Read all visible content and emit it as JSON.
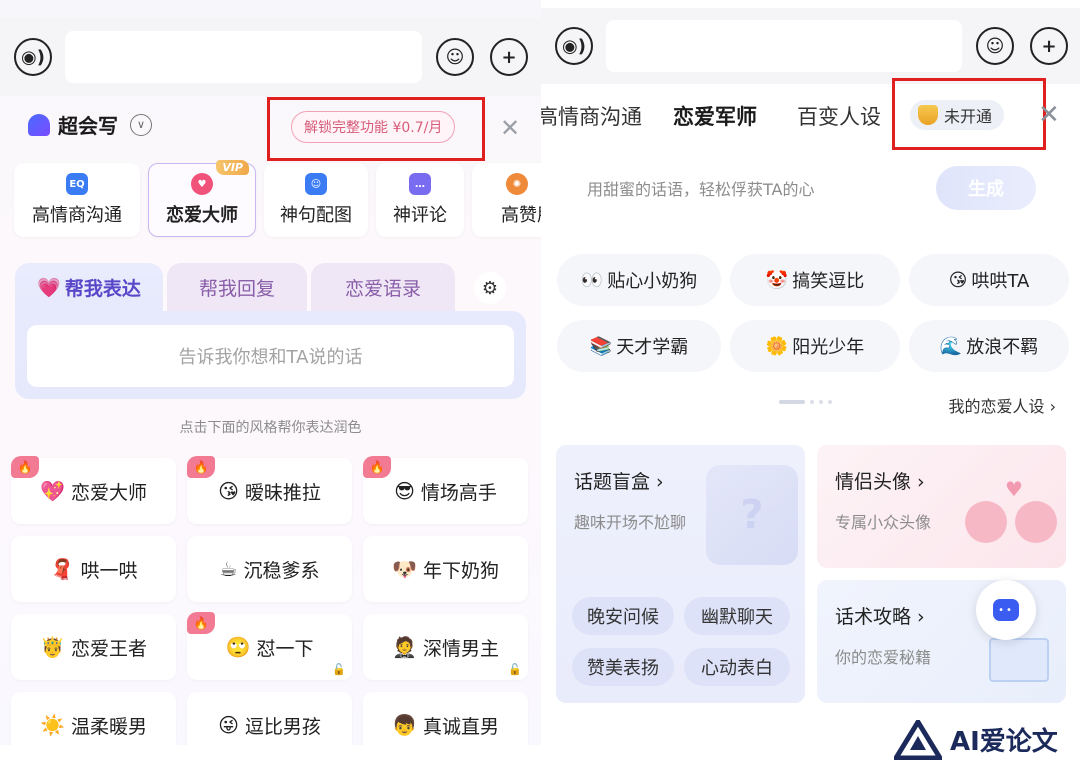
{
  "left": {
    "brand": "超会写",
    "unlock": "解锁完整功能 ¥0.7/月",
    "features": [
      {
        "label": "高情商沟通",
        "icon": "EQ",
        "color": "#3b7cf5"
      },
      {
        "label": "恋爱大师",
        "icon": "♥",
        "color": "#f0527a",
        "vip": "VIP"
      },
      {
        "label": "神句配图",
        "icon": "☺",
        "color": "#3b7cf5"
      },
      {
        "label": "神评论",
        "icon": "…",
        "color": "#7a6cf0"
      },
      {
        "label": "高赞朋",
        "icon": "✺",
        "color": "#f08a3b"
      }
    ],
    "subtabs": [
      "帮我表达",
      "帮我回复",
      "恋爱语录"
    ],
    "express_placeholder": "告诉我你想和TA说的话",
    "hint": "点击下面的风格帮你表达润色",
    "styles": [
      {
        "emoji": "💖",
        "label": "恋爱大师"
      },
      {
        "emoji": "😘",
        "label": "暧昧推拉"
      },
      {
        "emoji": "😎",
        "label": "情场高手"
      },
      {
        "emoji": "🧣",
        "label": "哄一哄"
      },
      {
        "emoji": "☕",
        "label": "沉稳爹系"
      },
      {
        "emoji": "🐶",
        "label": "年下奶狗"
      },
      {
        "emoji": "🤴",
        "label": "恋爱王者"
      },
      {
        "emoji": "🙄",
        "label": "怼一下"
      },
      {
        "emoji": "🤵",
        "label": "深情男主"
      },
      {
        "emoji": "☀️",
        "label": "温柔暖男"
      },
      {
        "emoji": "😜",
        "label": "逗比男孩"
      },
      {
        "emoji": "👦",
        "label": "真诚直男"
      }
    ]
  },
  "right": {
    "tabs": [
      "高情商沟通",
      "恋爱军师",
      "百变人设"
    ],
    "not_open": "未开通",
    "placeholder": "用甜蜜的话语，轻松俘获TA的心",
    "generate": "生成",
    "personas": [
      {
        "emoji": "👀",
        "label": "贴心小奶狗"
      },
      {
        "emoji": "🤡",
        "label": "搞笑逗比"
      },
      {
        "emoji": "😘",
        "label": "哄哄TA"
      },
      {
        "emoji": "📚",
        "label": "天才学霸"
      },
      {
        "emoji": "🌼",
        "label": "阳光少年"
      },
      {
        "emoji": "🌊",
        "label": "放浪不羁"
      }
    ],
    "my_persona": "我的恋爱人设 ›",
    "topic_box": {
      "title": "话题盲盒 ›",
      "sub": "趣味开场不尬聊",
      "chips": [
        "晚安问候",
        "幽默聊天",
        "赞美表扬",
        "心动表白"
      ]
    },
    "couple_avatar": {
      "title": "情侣头像 ›",
      "sub": "专属小众头像"
    },
    "talk_tips": {
      "title": "话术攻略 ›",
      "sub": "你的恋爱秘籍"
    }
  },
  "watermark": "AI爱论文"
}
